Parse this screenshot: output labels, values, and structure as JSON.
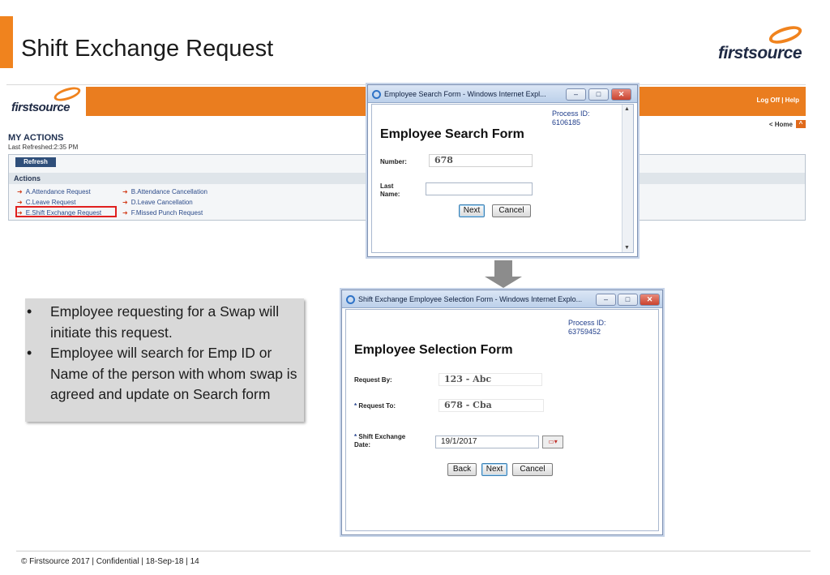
{
  "slide": {
    "title": "Shift Exchange Request",
    "brand": "firstsource",
    "footer": "© Firstsource 2017 | Confidential | 18-Sep-18 | 14"
  },
  "portal": {
    "brand": "firstsource",
    "top_links": "Log Off | Help",
    "home_link": "< Home",
    "my_actions": "MY ACTIONS",
    "last_refreshed": "Last Refreshed:2:35 PM",
    "refresh_button": "Refresh",
    "actions_heading": "Actions",
    "actions": [
      "A.Attendance Request",
      "B.Attendance Cancellation",
      "C.Leave Request",
      "D.Leave Cancellation",
      "E.Shift Exchange Request",
      "F.Missed Punch Request"
    ]
  },
  "search_window": {
    "title": "Employee Search Form - Windows Internet Expl...",
    "process_label": "Process ID:",
    "process_id": "6106185",
    "form_title": "Employee Search Form",
    "number_label": "Number:",
    "number_value": "678",
    "lastname_label": "Last Name:",
    "lastname_value": "",
    "next_button": "Next",
    "cancel_button": "Cancel"
  },
  "selection_window": {
    "title": "Shift Exchange Employee Selection Form - Windows Internet Explo...",
    "process_label": "Process ID:",
    "process_id": "63759452",
    "form_title": "Employee Selection Form",
    "request_by_label": "Request By:",
    "request_by_value": "123 - Abc",
    "request_to_label": "Request To:",
    "request_to_value": "678 - Cba",
    "shift_date_label_1": "Shift Exchange",
    "shift_date_label_2": "Date:",
    "shift_date_value": "19/1/2017",
    "back_button": "Back",
    "next_button": "Next",
    "cancel_button": "Cancel"
  },
  "bullets": [
    "Employee requesting for a Swap will initiate this request.",
    "Employee will search for Emp ID or Name of the person with whom swap is agreed and update on Search form"
  ],
  "colors": {
    "accent_orange": "#f0831e",
    "portal_orange": "#ea7d1f",
    "link_blue": "#2c4b8a",
    "highlight_red": "#e0201f"
  }
}
